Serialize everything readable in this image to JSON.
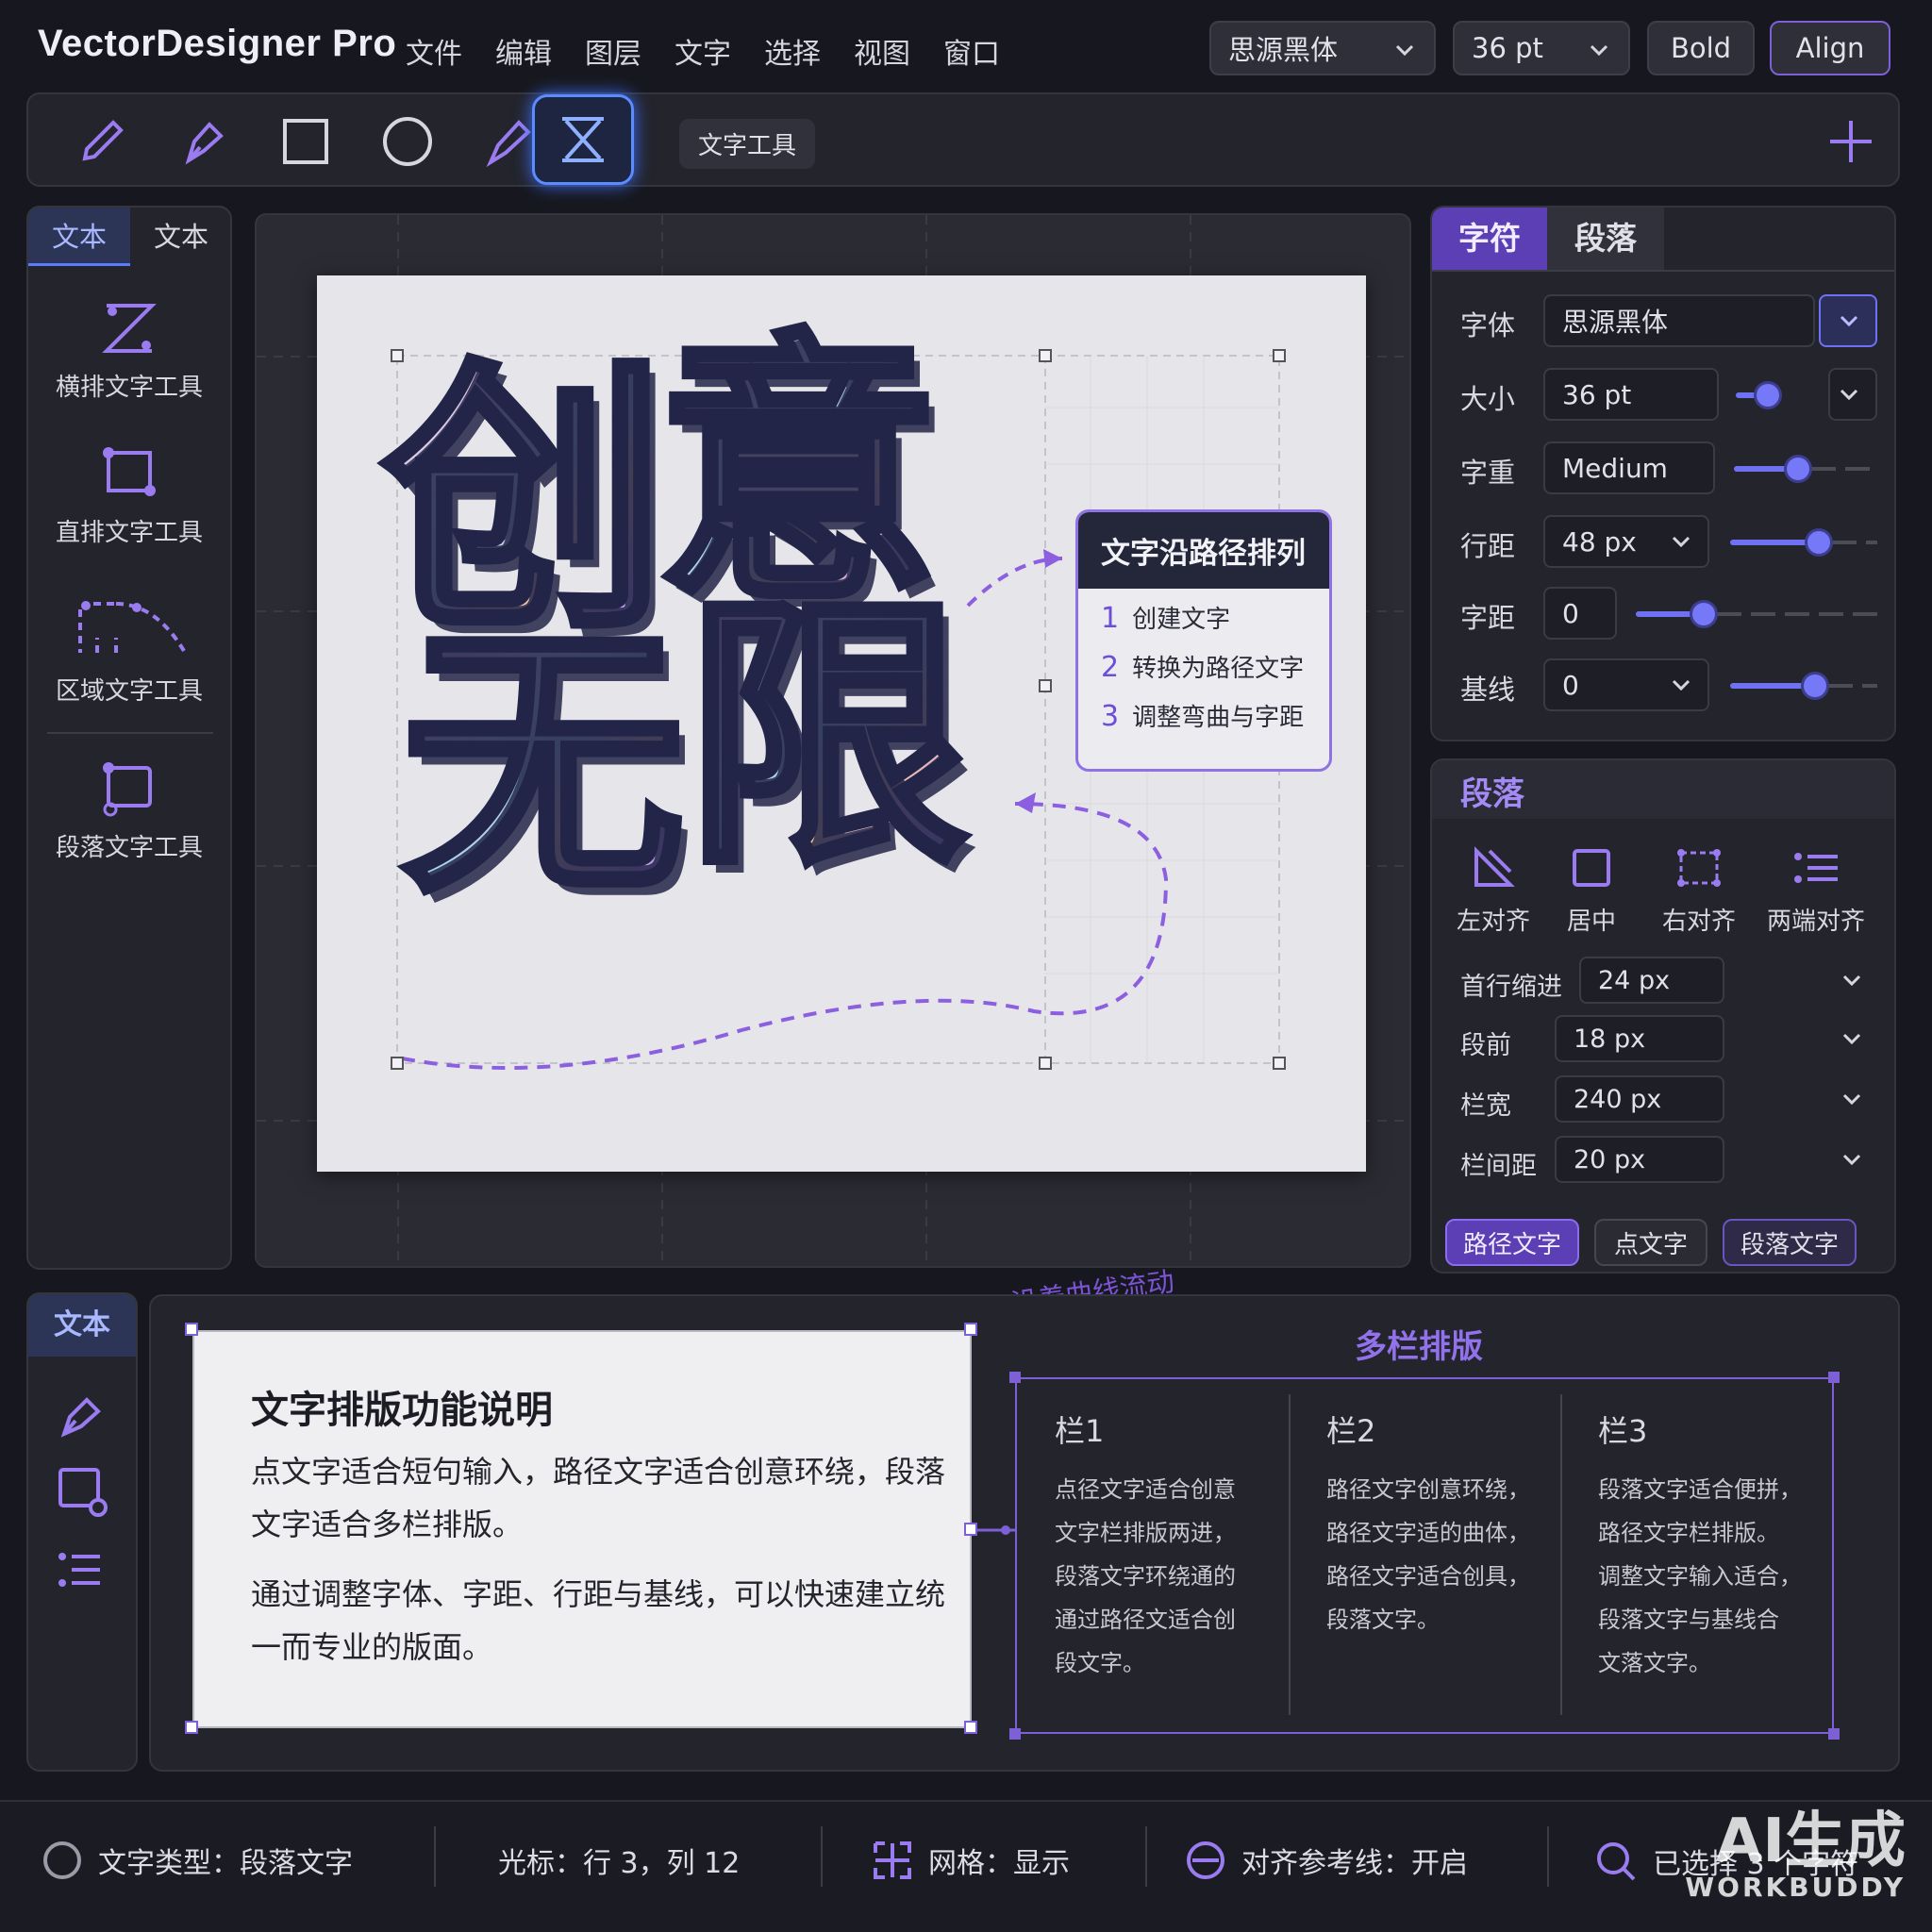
{
  "app": {
    "title": "VectorDesigner Pro"
  },
  "menu": [
    "文件",
    "编辑",
    "图层",
    "文字",
    "选择",
    "视图",
    "窗口"
  ],
  "top_controls": {
    "font": "思源黑体",
    "size": "36 pt",
    "bold": "Bold",
    "align": "Align"
  },
  "toolbar": {
    "active_tool_label": "文字工具"
  },
  "left_panel": {
    "tabs": [
      "文本",
      "文本"
    ],
    "items": [
      "横排文字工具",
      "直排文字工具",
      "区域文字工具",
      "段落文字工具"
    ]
  },
  "canvas": {
    "headline_line1": [
      "创",
      "意"
    ],
    "headline_line2": [
      "无",
      "限"
    ],
    "callout": {
      "title": "文字沿路径排列",
      "steps": [
        {
          "n": "1",
          "t": "创建文字"
        },
        {
          "n": "2",
          "t": "转换为路径文字"
        },
        {
          "n": "3",
          "t": "调整弯曲与字距"
        }
      ]
    },
    "curve_label": "沿着曲线流动"
  },
  "char_panel": {
    "tabs": [
      "字符",
      "段落"
    ],
    "rows": [
      {
        "label": "字体",
        "value": "思源黑体"
      },
      {
        "label": "大小",
        "value": "36 pt",
        "level": 0.45
      },
      {
        "label": "字重",
        "value": "Medium",
        "level": 0.45
      },
      {
        "label": "行距",
        "value": "48 px",
        "level": 0.6
      },
      {
        "label": "字距",
        "value": "0",
        "level": 0.28
      },
      {
        "label": "基线",
        "value": "0",
        "level": 0.58
      }
    ]
  },
  "para_panel": {
    "title": "段落",
    "align": [
      "左对齐",
      "居中",
      "右对齐",
      "两端对齐"
    ],
    "rows": [
      {
        "label": "首行缩进",
        "value": "24 px"
      },
      {
        "label": "段前",
        "value": "18 px"
      },
      {
        "label": "栏宽",
        "value": "240 px"
      },
      {
        "label": "栏间距",
        "value": "20 px"
      }
    ],
    "buttons": [
      "路径文字",
      "点文字",
      "段落文字"
    ]
  },
  "bottom": {
    "tab": "文本",
    "doc_title": "文字排版功能说明",
    "doc_p1": "点文字适合短句输入，路径文字适合创意环绕，段落文字适合多栏排版。",
    "doc_p2": "通过调整字体、字距、行距与基线，可以快速建立统一而专业的版面。",
    "multicol_title": "多栏排版",
    "columns": [
      {
        "h": "栏1",
        "t": "点径文字适合创意\n文字栏排版两进，\n段落文字环绕通的\n通过路径文适合创\n段文字。"
      },
      {
        "h": "栏2",
        "t": "路径文字创意环绕，\n路径文字适的曲体，\n路径文字适合创具，\n段落文字。"
      },
      {
        "h": "栏3",
        "t": "段落文字适合便拼，\n路径文字栏排版。\n调整文字输入适合，\n段落文字与基线合\n文落文字。"
      }
    ]
  },
  "status": {
    "type": "文字类型：段落文字",
    "cursor": "光标：行 3，列 12",
    "grid": "网格：显示",
    "guides": "对齐参考线：开启",
    "selection": "已选择 3 个字符"
  },
  "watermark": {
    "line1": "AI生成",
    "line2": "WORKBUDDY"
  },
  "colors": {
    "accent": "#7d5fd6",
    "slider": "#6e72f2",
    "active_tool": "#5a8cff"
  }
}
